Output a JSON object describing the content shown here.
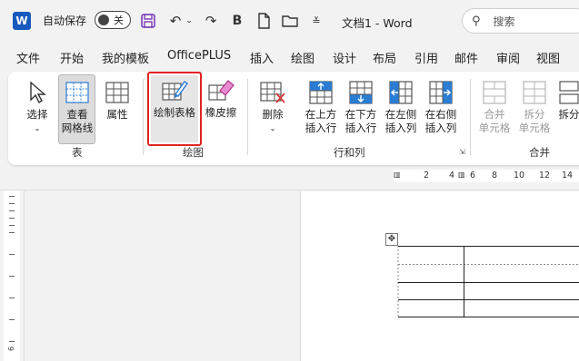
{
  "titlebar": {
    "autosave_label": "自动保存",
    "toggle_state": "关",
    "doc_title": "文档1  -  Word",
    "search_placeholder": "搜索",
    "word_logo": "W"
  },
  "menu": [
    "文件",
    "开始",
    "我的模板",
    "OfficePLUS",
    "插入",
    "绘图",
    "设计",
    "布局",
    "引用",
    "邮件",
    "审阅",
    "视图"
  ],
  "ribbon": {
    "table_group": {
      "label": "表",
      "select": "选择",
      "gridlines_line1": "查看",
      "gridlines_line2": "网格线",
      "properties": "属性"
    },
    "draw_group": {
      "label": "绘图",
      "draw_table": "绘制表格",
      "eraser": "橡皮擦"
    },
    "rows_cols_group": {
      "label": "行和列",
      "delete": "删除",
      "insert_above_1": "在上方",
      "insert_above_2": "插入行",
      "insert_below_1": "在下方",
      "insert_below_2": "插入行",
      "insert_left_1": "在左侧",
      "insert_left_2": "插入列",
      "insert_right_1": "在右侧",
      "insert_right_2": "插入列"
    },
    "merge_group": {
      "label": "合并",
      "merge_1": "合并",
      "merge_2": "单元格",
      "split_1": "拆分",
      "split_2": "单元格",
      "split_table": "拆分"
    }
  },
  "ruler": {
    "numbers": [
      "2",
      "4",
      "6",
      "8",
      "10",
      "12",
      "14"
    ]
  },
  "left_ruler": {
    "number": "6"
  },
  "colors": {
    "accent_red": "#e02424",
    "icon_blue": "#2b7cd3",
    "word_blue": "#185abd"
  }
}
